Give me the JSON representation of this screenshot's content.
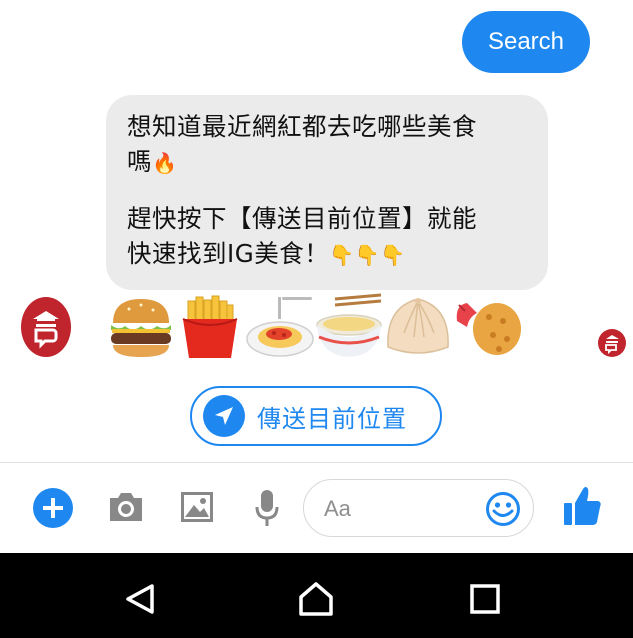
{
  "chat": {
    "sent_message": "Search",
    "received_message": {
      "line1": "想知道最近網紅都去吃哪些美食",
      "line2": "嗎",
      "line2_emoji": "🔥",
      "line3": "趕快按下【傳送目前位置】就能",
      "line4": "快速找到IG美食！",
      "line4_emoji": "👇👇👇"
    },
    "quick_reply": {
      "label": "傳送目前位置",
      "icon": "location-arrow-icon"
    }
  },
  "composer": {
    "placeholder": "Aa",
    "icons": [
      "plus-icon",
      "camera-icon",
      "image-icon",
      "microphone-icon",
      "smile-icon",
      "thumbs-up-icon"
    ]
  },
  "colors": {
    "accent": "#1e88f0",
    "brand_red": "#c0242c",
    "bubble_gray": "#ebebeb"
  },
  "food_icons": [
    "burger-icon",
    "fries-icon",
    "spaghetti-icon",
    "noodle-bowl-icon",
    "dumpling-icon",
    "shrimp-icon"
  ]
}
